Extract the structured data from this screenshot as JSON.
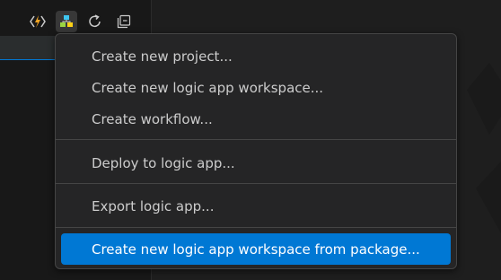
{
  "toolbar": {
    "buttons": [
      {
        "icon": "azure-functions-icon",
        "color": "#f5a623"
      },
      {
        "icon": "logic-apps-icon",
        "active": true
      },
      {
        "icon": "refresh-icon"
      },
      {
        "icon": "collapse-all-icon"
      }
    ]
  },
  "menu": {
    "groups": [
      [
        "Create new project...",
        "Create new logic app workspace...",
        "Create workflow..."
      ],
      [
        "Deploy to logic app..."
      ],
      [
        "Export logic app..."
      ],
      [
        "Create new logic app workspace from package..."
      ]
    ],
    "selected": "Create new logic app workspace from package...",
    "selected_color": "#0078d4"
  }
}
